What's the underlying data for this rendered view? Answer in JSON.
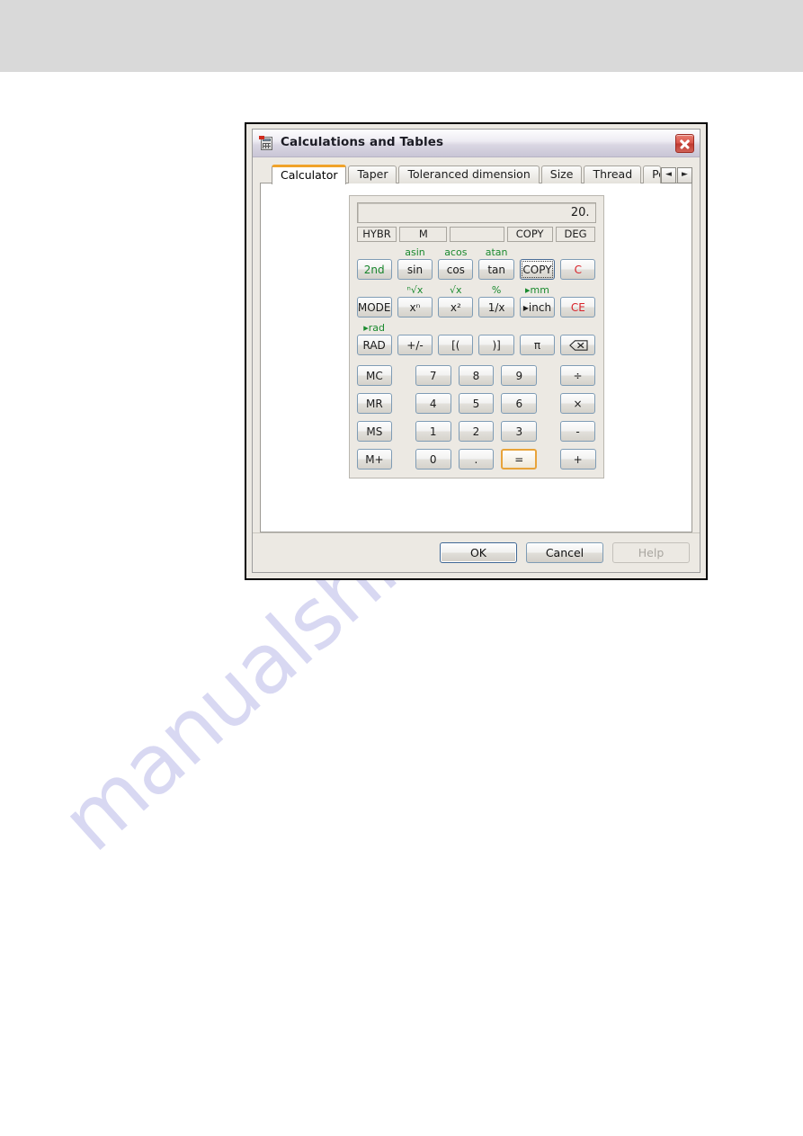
{
  "window": {
    "title": "Calculations and Tables",
    "icon": "calculator-icon",
    "close_label": "✕"
  },
  "tabs": {
    "items": [
      {
        "label": "Calculator",
        "active": true
      },
      {
        "label": "Taper",
        "active": false
      },
      {
        "label": "Toleranced dimension",
        "active": false
      },
      {
        "label": "Size",
        "active": false
      },
      {
        "label": "Thread",
        "active": false
      },
      {
        "label": "Polar",
        "active": false
      }
    ],
    "nav_prev": "◄",
    "nav_next": "►"
  },
  "calculator": {
    "display_value": "20.",
    "status": [
      {
        "label": "HYBR"
      },
      {
        "label": "M"
      },
      {
        "label": ""
      },
      {
        "label": "COPY"
      },
      {
        "label": "DEG"
      }
    ],
    "function_rows": [
      {
        "shift": [
          "",
          "asin",
          "acos",
          "atan",
          "",
          ""
        ],
        "keys": [
          {
            "label": "2nd",
            "style": "green"
          },
          {
            "label": "sin",
            "style": "normal"
          },
          {
            "label": "cos",
            "style": "normal"
          },
          {
            "label": "tan",
            "style": "normal"
          },
          {
            "label": "COPY",
            "style": "focus"
          },
          {
            "label": "C",
            "style": "red"
          }
        ]
      },
      {
        "shift": [
          "",
          "ⁿ√x",
          "√x",
          "%",
          "▸mm",
          ""
        ],
        "keys": [
          {
            "label": "MODE",
            "style": "normal"
          },
          {
            "label": "xⁿ",
            "style": "normal"
          },
          {
            "label": "x²",
            "style": "normal"
          },
          {
            "label": "1/x",
            "style": "normal"
          },
          {
            "label": "▸inch",
            "style": "normal"
          },
          {
            "label": "CE",
            "style": "red"
          }
        ]
      },
      {
        "shift": [
          "▸rad",
          "",
          "",
          "",
          "",
          ""
        ],
        "keys": [
          {
            "label": "RAD",
            "style": "normal"
          },
          {
            "label": "+/-",
            "style": "normal"
          },
          {
            "label": "[(",
            "style": "normal"
          },
          {
            "label": ")]",
            "style": "normal"
          },
          {
            "label": "π",
            "style": "normal"
          },
          {
            "label": "",
            "style": "backspace"
          }
        ]
      }
    ],
    "keypad_rows": [
      {
        "memory": "MC",
        "digits": [
          "7",
          "8",
          "9"
        ],
        "operator": {
          "label": "÷",
          "style": "normal"
        }
      },
      {
        "memory": "MR",
        "digits": [
          "4",
          "5",
          "6"
        ],
        "operator": {
          "label": "×",
          "style": "normal"
        }
      },
      {
        "memory": "MS",
        "digits": [
          "1",
          "2",
          "3"
        ],
        "operator": {
          "label": "-",
          "style": "normal"
        }
      },
      {
        "memory": "M+",
        "digits": [
          "0",
          ".",
          "="
        ],
        "operator": {
          "label": "+",
          "style": "normal"
        }
      }
    ]
  },
  "footer": {
    "ok": "OK",
    "cancel": "Cancel",
    "help": "Help"
  },
  "page": {
    "watermark": "manualshive.com"
  },
  "colors": {
    "accent_tab": "#f0a32a",
    "shift_green": "#16842a",
    "clear_red": "#d8232a",
    "close_red": "#c33b31",
    "equals_hover": "#e8a33a",
    "top_band": "#d9d9d9",
    "dialog_bg": "#ece9e3"
  }
}
